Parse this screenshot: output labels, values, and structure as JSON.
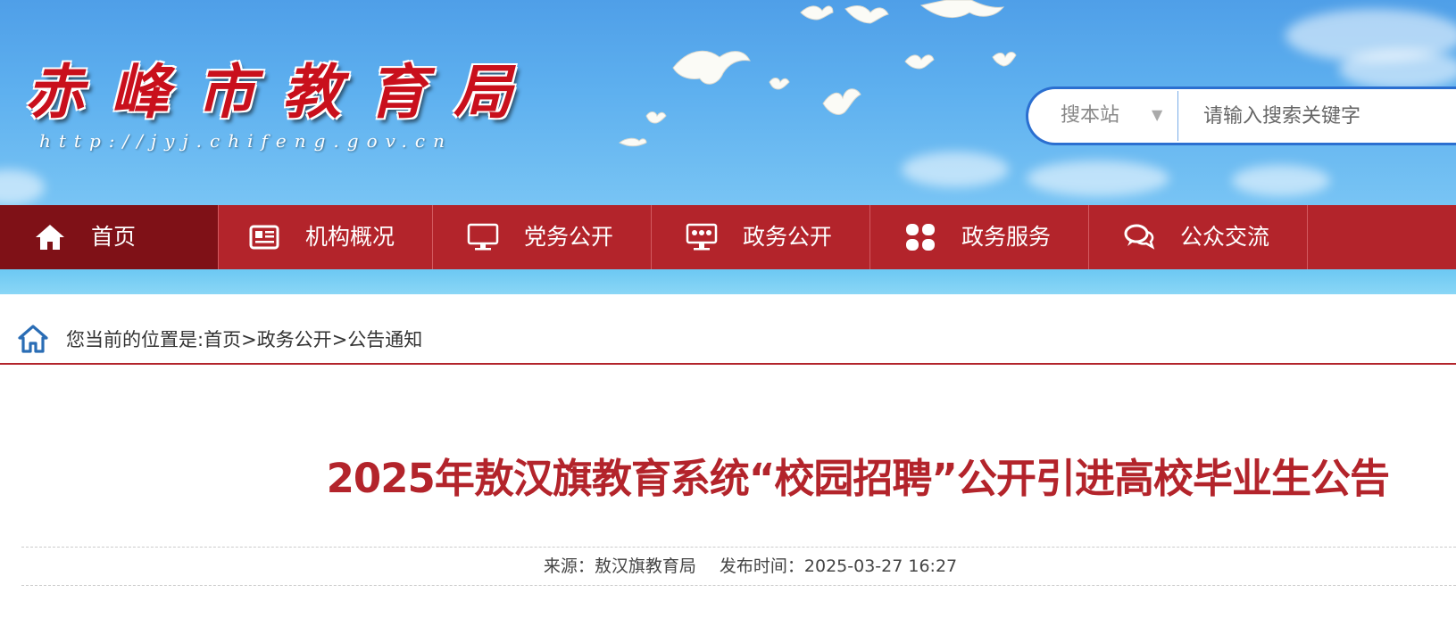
{
  "header": {
    "site_name": "赤峰市教育局",
    "site_url": "http://jyj.chifeng.gov.cn"
  },
  "search": {
    "scope": "搜本站",
    "scope_arrow": "▼",
    "placeholder": "请输入搜索关键字"
  },
  "nav": {
    "items": [
      {
        "label": "首页",
        "icon": "home-icon"
      },
      {
        "label": "机构概况",
        "icon": "newspaper-icon"
      },
      {
        "label": "党务公开",
        "icon": "monitor-icon"
      },
      {
        "label": "政务公开",
        "icon": "board-icon"
      },
      {
        "label": "政务服务",
        "icon": "grid-icon"
      },
      {
        "label": "公众交流",
        "icon": "chat-icon"
      }
    ]
  },
  "breadcrumb": {
    "prefix": "您当前的位置是:",
    "items": [
      "首页",
      "政务公开",
      "公告通知"
    ],
    "separator": ">"
  },
  "article": {
    "title": "2025年敖汉旗教育系统“校园招聘”公开引进高校毕业生公告",
    "source_label": "来源：",
    "source": "敖汉旗教育局",
    "time_label": "发布时间：",
    "time": "2025-03-27 16:27"
  },
  "colors": {
    "nav_bg": "#b3242b",
    "nav_active": "#7f1117",
    "title_red": "#b3242b",
    "search_border": "#2b6fd0"
  }
}
